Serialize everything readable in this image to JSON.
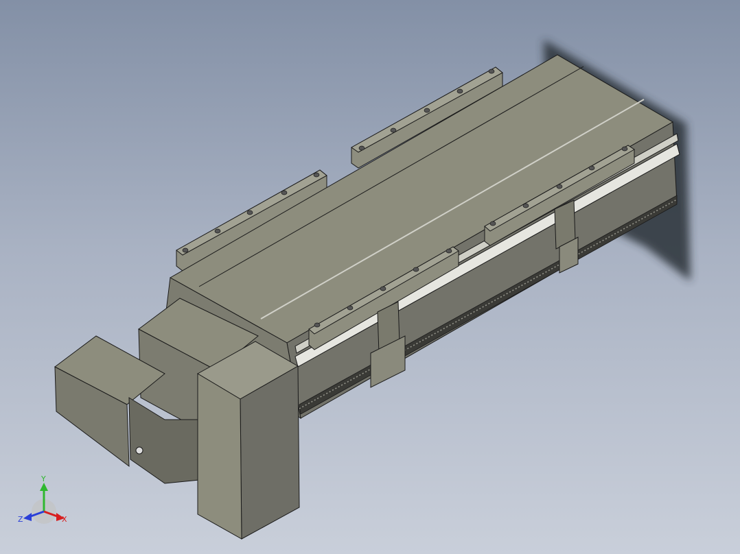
{
  "viewport": {
    "background_top": "#8390a6",
    "background_bottom": "#c9cfda",
    "model_color": "#8a8a7a",
    "edge_color": "#1a1a1a"
  },
  "triad": {
    "x_label": "X",
    "y_label": "Y",
    "z_label": "Z",
    "x_color": "#d81e1e",
    "y_color": "#2fb82f",
    "z_color": "#2a3fd8"
  }
}
